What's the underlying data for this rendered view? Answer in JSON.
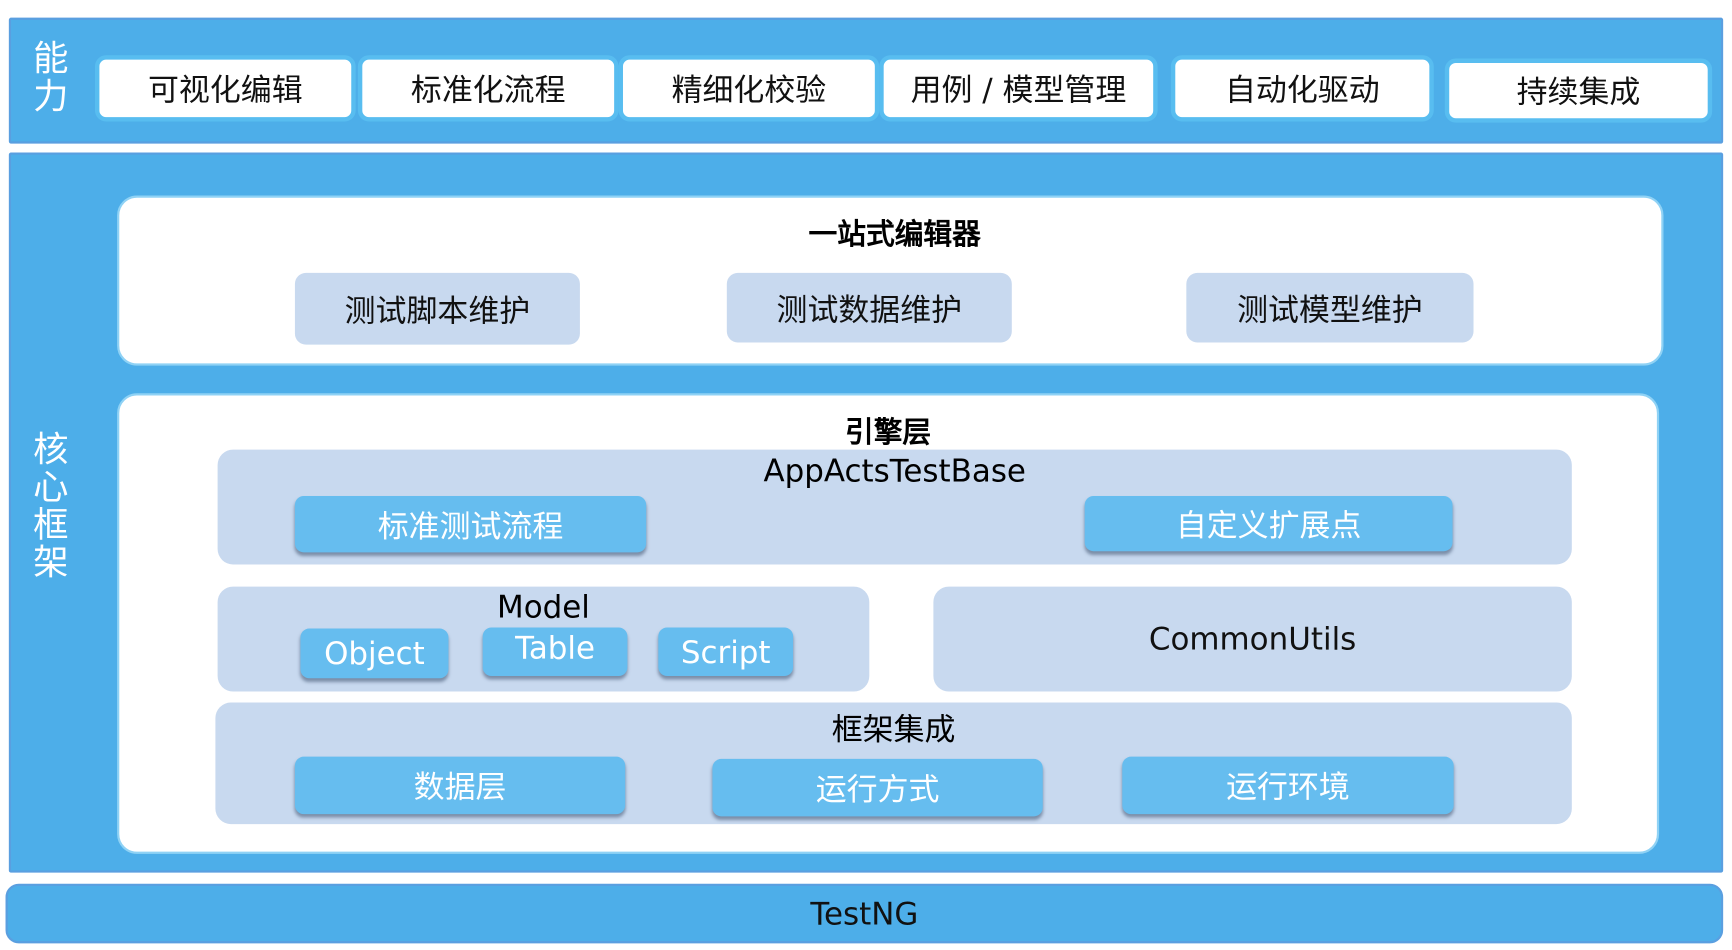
{
  "capability": {
    "label": "能力",
    "items": [
      "可视化编辑",
      "标准化流程",
      "精细化校验",
      "用例 / 模型管理",
      "自动化驱动",
      "持续集成"
    ]
  },
  "core": {
    "label": "核心框架",
    "editor": {
      "title": "一站式编辑器",
      "items": [
        "测试脚本维护",
        "测试数据维护",
        "测试模型维护"
      ]
    },
    "engine": {
      "title": "引擎层",
      "base": {
        "title": "AppActsTestBase",
        "items": [
          "标准测试流程",
          "自定义扩展点"
        ]
      },
      "model": {
        "title": "Model",
        "items": [
          "Object",
          "Table",
          "Script"
        ]
      },
      "utils": {
        "title": "CommonUtils"
      },
      "integration": {
        "title": "框架集成",
        "items": [
          "数据层",
          "运行方式",
          "运行环境"
        ]
      }
    }
  },
  "foundation": {
    "label": "TestNG"
  },
  "colors": {
    "band_blue": "#4daee9",
    "light_box": "#c8d9ef",
    "button_blue": "#66bdef",
    "white": "#ffffff"
  }
}
